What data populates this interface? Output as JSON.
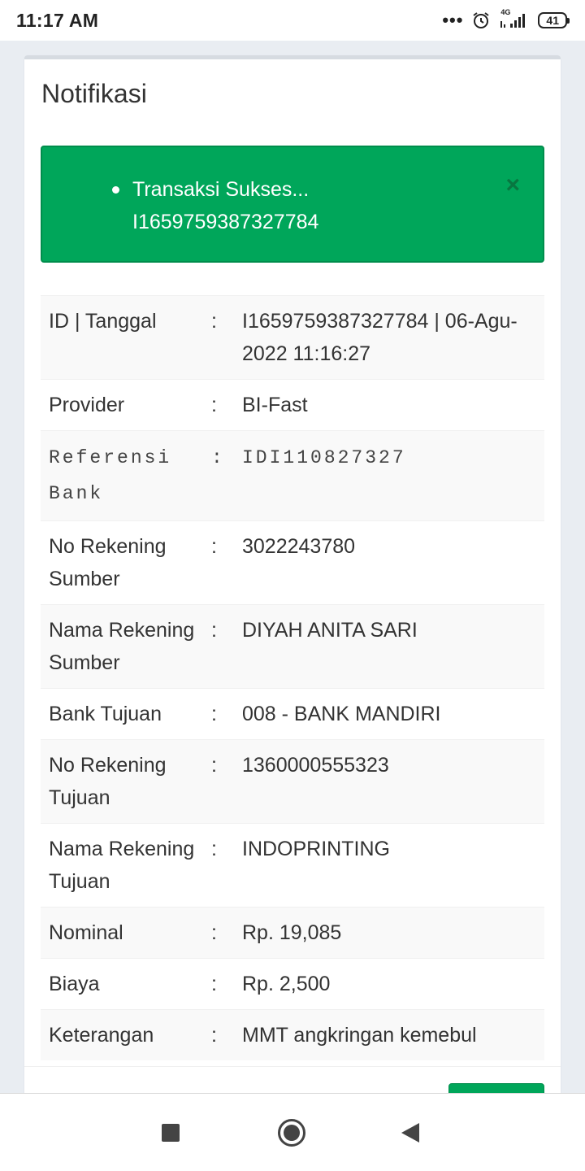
{
  "status_bar": {
    "time": "11:17 AM",
    "network": "4G",
    "battery": "41"
  },
  "card": {
    "title": "Notifikasi"
  },
  "alert": {
    "line1": "Transaksi Sukses...",
    "line2": "I1659759387327784",
    "close": "×"
  },
  "details": {
    "rows": [
      {
        "label": "ID | Tanggal",
        "colon": ":",
        "value": "I1659759387327784 | 06-Agu-2022 11:16:27"
      },
      {
        "label": "Provider",
        "colon": ":",
        "value": "BI-Fast"
      },
      {
        "label": "Referensi Bank",
        "colon": ":",
        "value": "IDI110827327"
      },
      {
        "label": "No Rekening Sumber",
        "colon": ":",
        "value": "3022243780"
      },
      {
        "label": "Nama Rekening Sumber",
        "colon": ":",
        "value": "DIYAH ANITA SARI"
      },
      {
        "label": "Bank Tujuan",
        "colon": ":",
        "value": "008 - BANK MANDIRI"
      },
      {
        "label": "No Rekening Tujuan",
        "colon": ":",
        "value": "1360000555323"
      },
      {
        "label": "Nama Rekening Tujuan",
        "colon": ":",
        "value": "INDOPRINTING"
      },
      {
        "label": "Nominal",
        "colon": ":",
        "value": "Rp. 19,085"
      },
      {
        "label": "Biaya",
        "colon": ":",
        "value": "Rp. 2,500"
      },
      {
        "label": "Keterangan",
        "colon": ":",
        "value": "MMT angkringan kemebul"
      }
    ]
  },
  "colors": {
    "success": "#00a65a",
    "success_border": "#008d4c"
  },
  "nav": {
    "icons": [
      "recents-icon",
      "home-icon",
      "back-icon"
    ]
  }
}
